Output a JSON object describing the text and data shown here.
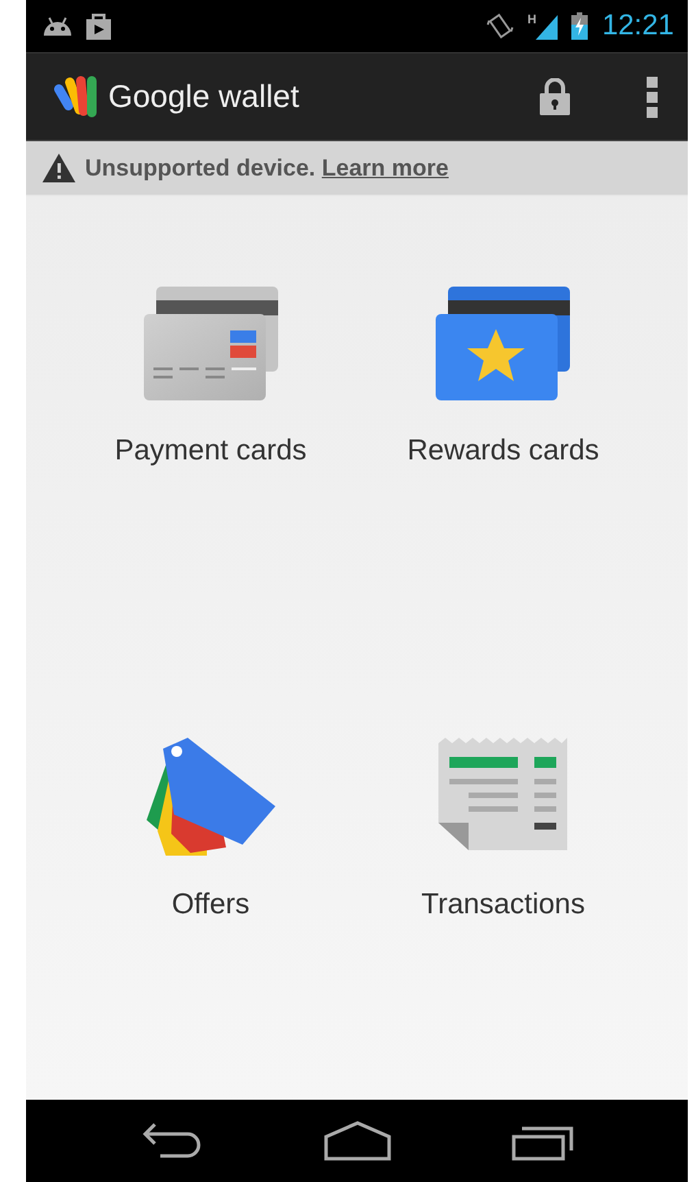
{
  "status_bar": {
    "network_type": "H",
    "time": "12:21"
  },
  "action_bar": {
    "title": "Google wallet"
  },
  "banner": {
    "message": "Unsupported device.",
    "link": "Learn more"
  },
  "tiles": [
    {
      "kind": "payment",
      "label": "Payment cards"
    },
    {
      "kind": "rewards",
      "label": "Rewards cards"
    },
    {
      "kind": "offers",
      "label": "Offers"
    },
    {
      "kind": "transactions",
      "label": "Transactions"
    }
  ]
}
